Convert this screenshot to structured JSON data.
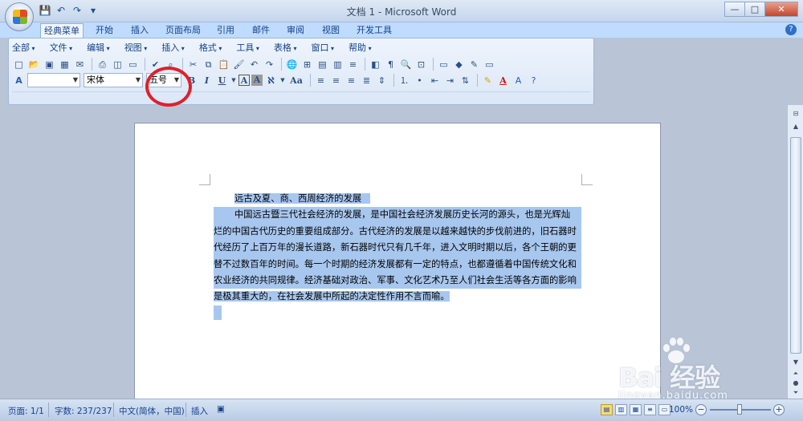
{
  "window": {
    "title": "文档 1 - Microsoft Word",
    "controls": {
      "minimize": "—",
      "maximize": "□",
      "close": "✕"
    }
  },
  "quick_access": {
    "save": "💾",
    "undo": "↶",
    "redo": "↷",
    "more": "▾"
  },
  "ribbon_tabs": [
    "经典菜单",
    "开始",
    "插入",
    "页面布局",
    "引用",
    "邮件",
    "审阅",
    "视图",
    "开发工具"
  ],
  "active_tab": "经典菜单",
  "classic_menu": [
    "全部",
    "文件",
    "编辑",
    "视图",
    "插入",
    "格式",
    "工具",
    "表格",
    "窗口",
    "帮助"
  ],
  "formatting": {
    "style_value": "",
    "font_value": "宋体",
    "size_value": "五号",
    "bold": "B",
    "italic": "I",
    "underline": "U",
    "char_border": "A",
    "char_shading": "A",
    "change_case": "Aa"
  },
  "document": {
    "heading": "远古及夏、商、西周经济的发展",
    "paragraph_lines": [
      "中国远古暨三代社会经济的发展，是中国社会经济发展历史长河的源头，也是光辉灿",
      "烂的中国古代历史的重要组成部分。古代经济的发展是以越来越快的步伐前进的，旧石器时",
      "代经历了上百万年的漫长道路，新石器时代只有几千年，进入文明时期以后，各个王朝的更",
      "替不过数百年的时间。每一个时期的经济发展都有一定的特点，也都遵循着中国传统文化和",
      "农业经济的共同规律。经济基础对政治、军事、文化艺术乃至人们社会生活等各方面的影响",
      "是极其重大的，在社会发展中所起的决定性作用不言而喻。"
    ]
  },
  "status_bar": {
    "page": "页面: 1/1",
    "words": "字数: 237/237",
    "language": "中文(简体，中国)",
    "mode": "插入",
    "zoom": "100%"
  },
  "watermark": {
    "brand": "Bai 经验",
    "url": "jingyan.baidu.com"
  },
  "colors": {
    "highlight": "#a8c7ef",
    "annotation": "#e0202b",
    "ribbon_bg": "#dbe7f7"
  }
}
